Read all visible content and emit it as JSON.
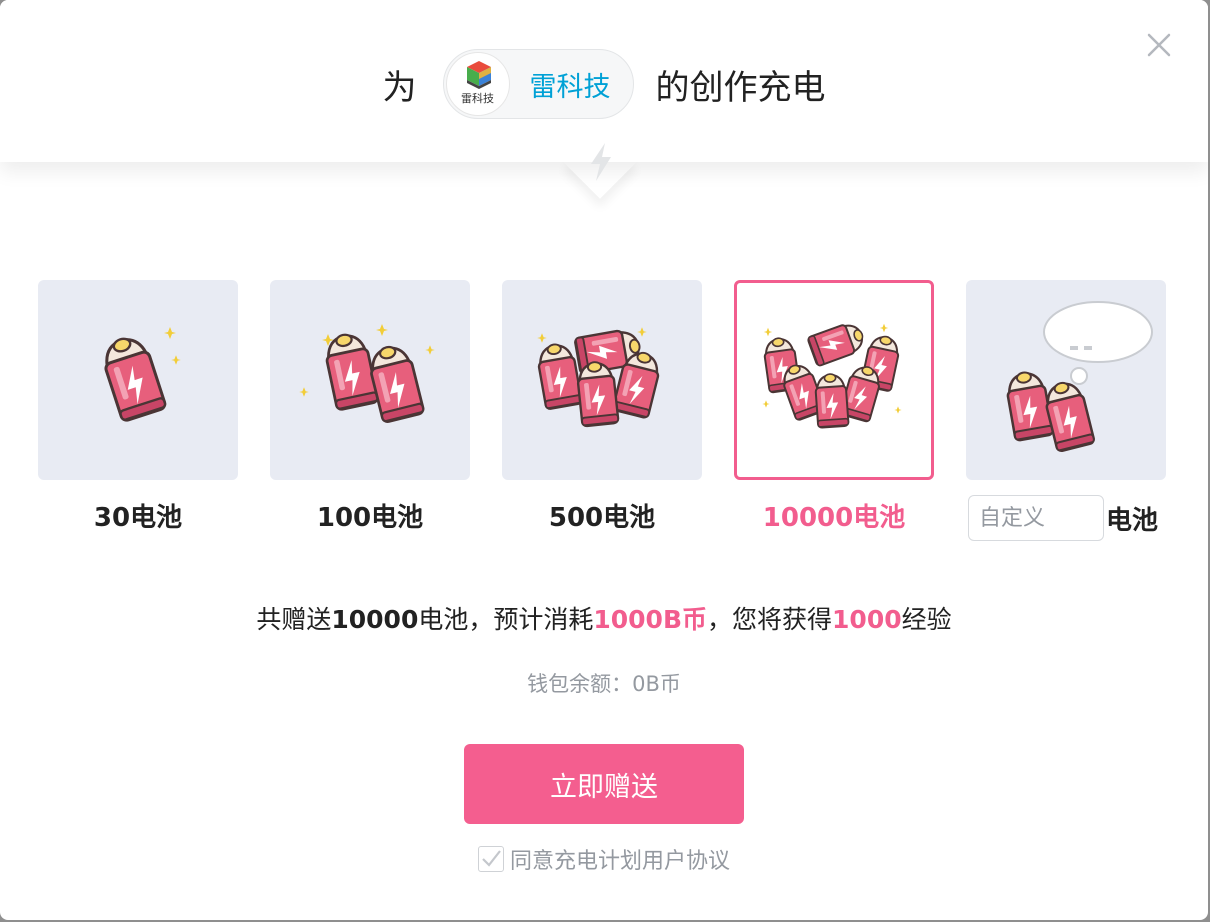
{
  "header": {
    "title_prefix": "为",
    "title_suffix": "的创作充电",
    "author": {
      "name": "雷科技",
      "avatar_text": "雷科技"
    }
  },
  "options": [
    {
      "label": "30电池",
      "selected": false,
      "icon": "single-battery"
    },
    {
      "label": "100电池",
      "selected": false,
      "icon": "two-batteries"
    },
    {
      "label": "500电池",
      "selected": false,
      "icon": "battery-pile"
    },
    {
      "label": "10000电池",
      "selected": true,
      "icon": "battery-heap"
    },
    {
      "label": "电池",
      "placeholder": "自定义",
      "value": "",
      "icon": "batteries-with-speech-bubble"
    }
  ],
  "summary": {
    "t1": "共赠送",
    "battery_count": "10000",
    "t2": "电池，预计消耗",
    "cost": "1000B币",
    "t3": "，您将获得",
    "exp": "1000",
    "t4": "经验"
  },
  "wallet": {
    "text": "钱包余额：0B币"
  },
  "submit_label": "立即赠送",
  "agreement": {
    "label": "同意充电计划用户协议",
    "checked": true
  },
  "colors": {
    "accent": "#f25d8e",
    "author_link": "#00a1d6",
    "card_bg": "#e8ebf3",
    "muted_text": "#9499a0"
  }
}
